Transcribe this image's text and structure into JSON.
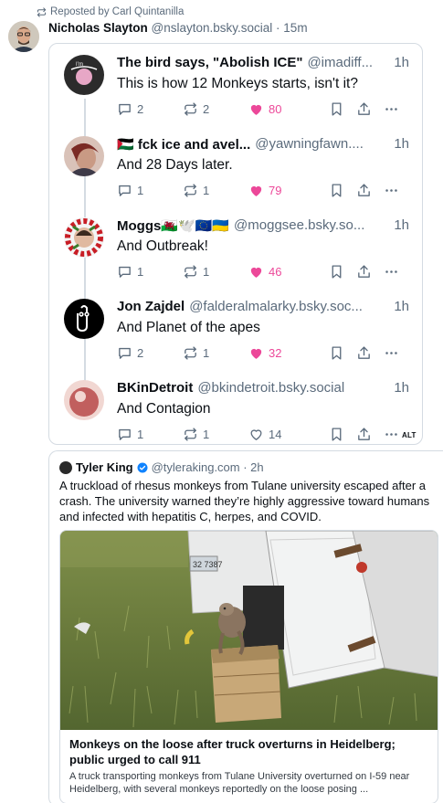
{
  "repost": {
    "label": "Reposted by Carl Quintanilla"
  },
  "main": {
    "name": "Nicholas Slayton",
    "handle": "@nslayton.bsky.social · 15m"
  },
  "thread": [
    {
      "name": "The bird says, \"Abolish ICE\"",
      "handle": "@imadiff...",
      "time": "1h",
      "text": "This is how 12 Monkeys starts, isn't it?",
      "replies": "2",
      "reposts": "2",
      "likes": "80",
      "liked": true,
      "avatar_colors": [
        "#2b2b2b",
        "#e7a7c6"
      ]
    },
    {
      "name": "🇵🇸 fck ice and avel...",
      "handle": "@yawningfawn....",
      "time": "1h",
      "text": "And 28 Days later.",
      "replies": "1",
      "reposts": "1",
      "likes": "79",
      "liked": true,
      "avatar_colors": [
        "#7a2a24",
        "#d9c2b8"
      ]
    },
    {
      "name": "Moggs🏴󠁧󠁢󠁷󠁬󠁳󠁿🕊️🇪🇺🇺🇦",
      "handle": "@moggsee.bsky.so...",
      "time": "1h",
      "text": "And Outbreak!",
      "replies": "1",
      "reposts": "1",
      "likes": "46",
      "liked": true,
      "avatar_colors": [
        "#c81d25",
        "#3a7d2c"
      ]
    },
    {
      "name": "Jon Zajdel",
      "handle": "@falderalmalarky.bsky.soc...",
      "time": "1h",
      "text": "And Planet of the apes",
      "replies": "2",
      "reposts": "1",
      "likes": "32",
      "liked": true,
      "avatar_colors": [
        "#000000",
        "#ffffff"
      ]
    },
    {
      "name": "BKinDetroit",
      "handle": "@bkindetroit.bsky.social",
      "time": "1h",
      "text": "And Contagion",
      "replies": "1",
      "reposts": "1",
      "likes": "14",
      "liked": false,
      "avatar_colors": [
        "#b94a4a",
        "#f1d7d2"
      ]
    }
  ],
  "alt_badge": "ALT",
  "quoted": {
    "name": "Tyler King",
    "handle": "@tyleraking.com · 2h",
    "text": "A truckload of rhesus monkeys from Tulane university escaped after a crash. The university warned they’re highly aggressive toward humans and infected with hepatitis C, herpes, and COVID.",
    "card": {
      "title": "Monkeys on the loose after truck overturns in Heidelberg; public urged to call 911",
      "description": "A truck transporting monkeys from Tulane University overturned on I-59 near Heidelberg, with several monkeys reportedly on the loose posing ..."
    }
  },
  "colors": {
    "like_active": "#ec4899",
    "muted_text": "#5b6b7c",
    "border": "#d4dbe2",
    "verified": "#1083fe"
  },
  "icons": [
    "repost-icon",
    "reply-icon",
    "like-icon",
    "bookmark-icon",
    "share-icon",
    "more-icon",
    "verified-icon"
  ]
}
